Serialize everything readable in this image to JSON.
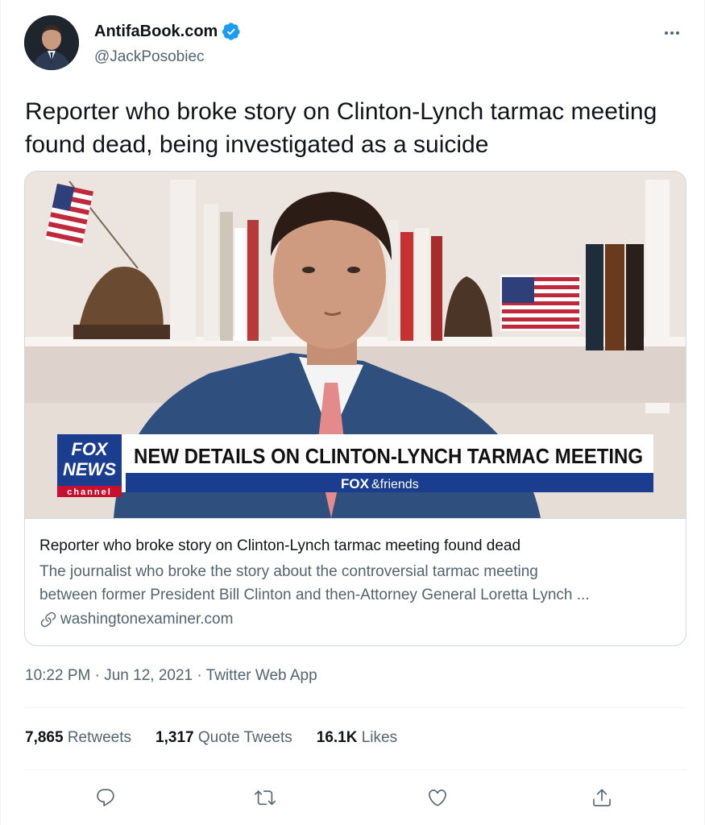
{
  "author": {
    "display_name": "AntifaBook.com",
    "handle": "@JackPosobiec",
    "verified_icon": "verified-badge-icon"
  },
  "more_icon": "more-horizontal-icon",
  "tweet": {
    "text": "Reporter who broke story on Clinton-Lynch tarmac meeting found dead, being investigated as a suicide"
  },
  "card": {
    "chyron_logo_line1": "FOX",
    "chyron_logo_line2": "NEWS",
    "chyron_logo_line3": "channel",
    "chyron_headline": "NEW DETAILS ON CLINTON-LYNCH TARMAC MEETING",
    "chyron_show_brand": "FOX",
    "chyron_show_name": "&friends",
    "title": "Reporter who broke story on Clinton-Lynch tarmac meeting found dead",
    "description_line1": "The journalist who broke the story about the controversial tarmac meeting",
    "description_line2": "between former President Bill Clinton and then-Attorney General Loretta Lynch ...",
    "link": "washingtonexaminer.com",
    "link_icon": "link-icon"
  },
  "meta": {
    "time": "10:22 PM",
    "date": "Jun 12, 2021",
    "source": "Twitter Web App",
    "separator": "·"
  },
  "stats": [
    {
      "count": "7,865",
      "label": "Retweets"
    },
    {
      "count": "1,317",
      "label": "Quote Tweets"
    },
    {
      "count": "16.1K",
      "label": "Likes"
    }
  ],
  "actions": [
    "reply-icon",
    "retweet-icon",
    "like-icon",
    "share-icon"
  ],
  "colors": {
    "verified": "#1d9bf0",
    "secondary_text": "#536471",
    "chyron_blue": "#1a3d8f",
    "fox_red": "#c8102e"
  }
}
